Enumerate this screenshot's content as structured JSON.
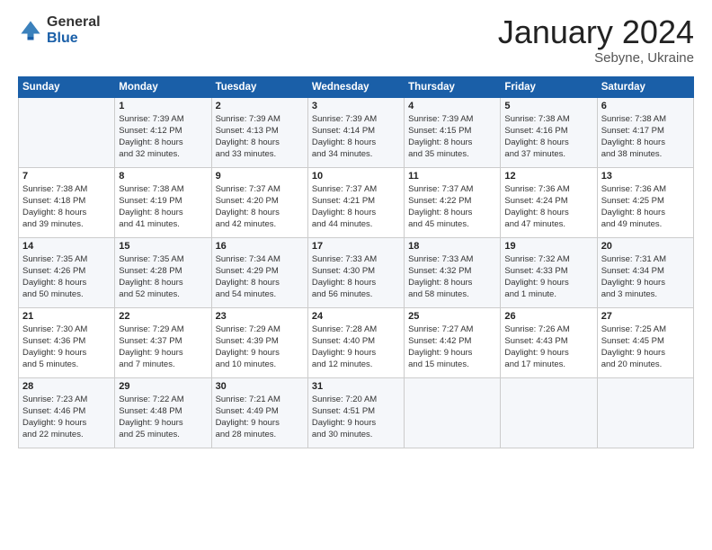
{
  "header": {
    "logo_general": "General",
    "logo_blue": "Blue",
    "title": "January 2024",
    "location": "Sebyne, Ukraine"
  },
  "days_of_week": [
    "Sunday",
    "Monday",
    "Tuesday",
    "Wednesday",
    "Thursday",
    "Friday",
    "Saturday"
  ],
  "weeks": [
    [
      {
        "day": "",
        "lines": []
      },
      {
        "day": "1",
        "lines": [
          "Sunrise: 7:39 AM",
          "Sunset: 4:12 PM",
          "Daylight: 8 hours",
          "and 32 minutes."
        ]
      },
      {
        "day": "2",
        "lines": [
          "Sunrise: 7:39 AM",
          "Sunset: 4:13 PM",
          "Daylight: 8 hours",
          "and 33 minutes."
        ]
      },
      {
        "day": "3",
        "lines": [
          "Sunrise: 7:39 AM",
          "Sunset: 4:14 PM",
          "Daylight: 8 hours",
          "and 34 minutes."
        ]
      },
      {
        "day": "4",
        "lines": [
          "Sunrise: 7:39 AM",
          "Sunset: 4:15 PM",
          "Daylight: 8 hours",
          "and 35 minutes."
        ]
      },
      {
        "day": "5",
        "lines": [
          "Sunrise: 7:38 AM",
          "Sunset: 4:16 PM",
          "Daylight: 8 hours",
          "and 37 minutes."
        ]
      },
      {
        "day": "6",
        "lines": [
          "Sunrise: 7:38 AM",
          "Sunset: 4:17 PM",
          "Daylight: 8 hours",
          "and 38 minutes."
        ]
      }
    ],
    [
      {
        "day": "7",
        "lines": [
          "Sunrise: 7:38 AM",
          "Sunset: 4:18 PM",
          "Daylight: 8 hours",
          "and 39 minutes."
        ]
      },
      {
        "day": "8",
        "lines": [
          "Sunrise: 7:38 AM",
          "Sunset: 4:19 PM",
          "Daylight: 8 hours",
          "and 41 minutes."
        ]
      },
      {
        "day": "9",
        "lines": [
          "Sunrise: 7:37 AM",
          "Sunset: 4:20 PM",
          "Daylight: 8 hours",
          "and 42 minutes."
        ]
      },
      {
        "day": "10",
        "lines": [
          "Sunrise: 7:37 AM",
          "Sunset: 4:21 PM",
          "Daylight: 8 hours",
          "and 44 minutes."
        ]
      },
      {
        "day": "11",
        "lines": [
          "Sunrise: 7:37 AM",
          "Sunset: 4:22 PM",
          "Daylight: 8 hours",
          "and 45 minutes."
        ]
      },
      {
        "day": "12",
        "lines": [
          "Sunrise: 7:36 AM",
          "Sunset: 4:24 PM",
          "Daylight: 8 hours",
          "and 47 minutes."
        ]
      },
      {
        "day": "13",
        "lines": [
          "Sunrise: 7:36 AM",
          "Sunset: 4:25 PM",
          "Daylight: 8 hours",
          "and 49 minutes."
        ]
      }
    ],
    [
      {
        "day": "14",
        "lines": [
          "Sunrise: 7:35 AM",
          "Sunset: 4:26 PM",
          "Daylight: 8 hours",
          "and 50 minutes."
        ]
      },
      {
        "day": "15",
        "lines": [
          "Sunrise: 7:35 AM",
          "Sunset: 4:28 PM",
          "Daylight: 8 hours",
          "and 52 minutes."
        ]
      },
      {
        "day": "16",
        "lines": [
          "Sunrise: 7:34 AM",
          "Sunset: 4:29 PM",
          "Daylight: 8 hours",
          "and 54 minutes."
        ]
      },
      {
        "day": "17",
        "lines": [
          "Sunrise: 7:33 AM",
          "Sunset: 4:30 PM",
          "Daylight: 8 hours",
          "and 56 minutes."
        ]
      },
      {
        "day": "18",
        "lines": [
          "Sunrise: 7:33 AM",
          "Sunset: 4:32 PM",
          "Daylight: 8 hours",
          "and 58 minutes."
        ]
      },
      {
        "day": "19",
        "lines": [
          "Sunrise: 7:32 AM",
          "Sunset: 4:33 PM",
          "Daylight: 9 hours",
          "and 1 minute."
        ]
      },
      {
        "day": "20",
        "lines": [
          "Sunrise: 7:31 AM",
          "Sunset: 4:34 PM",
          "Daylight: 9 hours",
          "and 3 minutes."
        ]
      }
    ],
    [
      {
        "day": "21",
        "lines": [
          "Sunrise: 7:30 AM",
          "Sunset: 4:36 PM",
          "Daylight: 9 hours",
          "and 5 minutes."
        ]
      },
      {
        "day": "22",
        "lines": [
          "Sunrise: 7:29 AM",
          "Sunset: 4:37 PM",
          "Daylight: 9 hours",
          "and 7 minutes."
        ]
      },
      {
        "day": "23",
        "lines": [
          "Sunrise: 7:29 AM",
          "Sunset: 4:39 PM",
          "Daylight: 9 hours",
          "and 10 minutes."
        ]
      },
      {
        "day": "24",
        "lines": [
          "Sunrise: 7:28 AM",
          "Sunset: 4:40 PM",
          "Daylight: 9 hours",
          "and 12 minutes."
        ]
      },
      {
        "day": "25",
        "lines": [
          "Sunrise: 7:27 AM",
          "Sunset: 4:42 PM",
          "Daylight: 9 hours",
          "and 15 minutes."
        ]
      },
      {
        "day": "26",
        "lines": [
          "Sunrise: 7:26 AM",
          "Sunset: 4:43 PM",
          "Daylight: 9 hours",
          "and 17 minutes."
        ]
      },
      {
        "day": "27",
        "lines": [
          "Sunrise: 7:25 AM",
          "Sunset: 4:45 PM",
          "Daylight: 9 hours",
          "and 20 minutes."
        ]
      }
    ],
    [
      {
        "day": "28",
        "lines": [
          "Sunrise: 7:23 AM",
          "Sunset: 4:46 PM",
          "Daylight: 9 hours",
          "and 22 minutes."
        ]
      },
      {
        "day": "29",
        "lines": [
          "Sunrise: 7:22 AM",
          "Sunset: 4:48 PM",
          "Daylight: 9 hours",
          "and 25 minutes."
        ]
      },
      {
        "day": "30",
        "lines": [
          "Sunrise: 7:21 AM",
          "Sunset: 4:49 PM",
          "Daylight: 9 hours",
          "and 28 minutes."
        ]
      },
      {
        "day": "31",
        "lines": [
          "Sunrise: 7:20 AM",
          "Sunset: 4:51 PM",
          "Daylight: 9 hours",
          "and 30 minutes."
        ]
      },
      {
        "day": "",
        "lines": []
      },
      {
        "day": "",
        "lines": []
      },
      {
        "day": "",
        "lines": []
      }
    ]
  ]
}
